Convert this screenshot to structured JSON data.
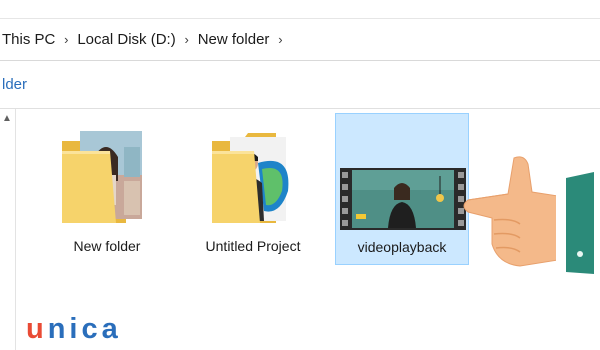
{
  "breadcrumb": [
    "This PC",
    "Local Disk (D:)",
    "New folder"
  ],
  "nav_pane_label": "lder",
  "items": [
    {
      "label": "New folder",
      "type": "folder-with-photos",
      "selected": false
    },
    {
      "label": "Untitled Project",
      "type": "folder-with-person",
      "selected": false
    },
    {
      "label": "videoplayback",
      "type": "video-file",
      "selected": true
    }
  ],
  "logo": {
    "first": "u",
    "rest": "nica"
  },
  "colors": {
    "selection": "#cce8ff",
    "selection_border": "#99d1ff",
    "folder": "#f6d36b",
    "logo_red": "#e94b35",
    "logo_blue": "#2a6ebb"
  }
}
